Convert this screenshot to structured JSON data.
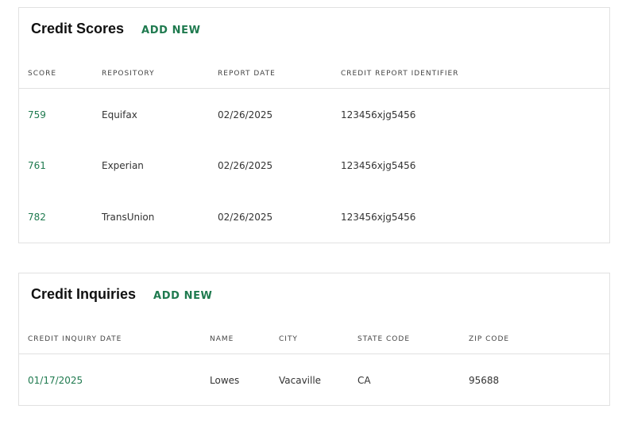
{
  "credit_scores": {
    "title": "Credit Scores",
    "add_new_label": "ADD NEW",
    "columns": [
      "SCORE",
      "REPOSITORY",
      "REPORT DATE",
      "CREDIT REPORT IDENTIFIER"
    ],
    "rows": [
      {
        "score": "759",
        "repository": "Equifax",
        "report_date": "02/26/2025",
        "identifier": "123456xjg5456"
      },
      {
        "score": "761",
        "repository": "Experian",
        "report_date": "02/26/2025",
        "identifier": "123456xjg5456"
      },
      {
        "score": "782",
        "repository": "TransUnion",
        "report_date": "02/26/2025",
        "identifier": "123456xjg5456"
      }
    ]
  },
  "credit_inquiries": {
    "title": "Credit Inquiries",
    "add_new_label": "ADD NEW",
    "columns": [
      "CREDIT INQUIRY DATE",
      "NAME",
      "CITY",
      "STATE CODE",
      "ZIP CODE"
    ],
    "rows": [
      {
        "inquiry_date": "01/17/2025",
        "name": "Lowes",
        "city": "Vacaville",
        "state_code": "CA",
        "zip_code": "95688"
      }
    ]
  },
  "colors": {
    "accent": "#1f7a4f",
    "border": "#e1e1e1",
    "title": "#111111"
  }
}
